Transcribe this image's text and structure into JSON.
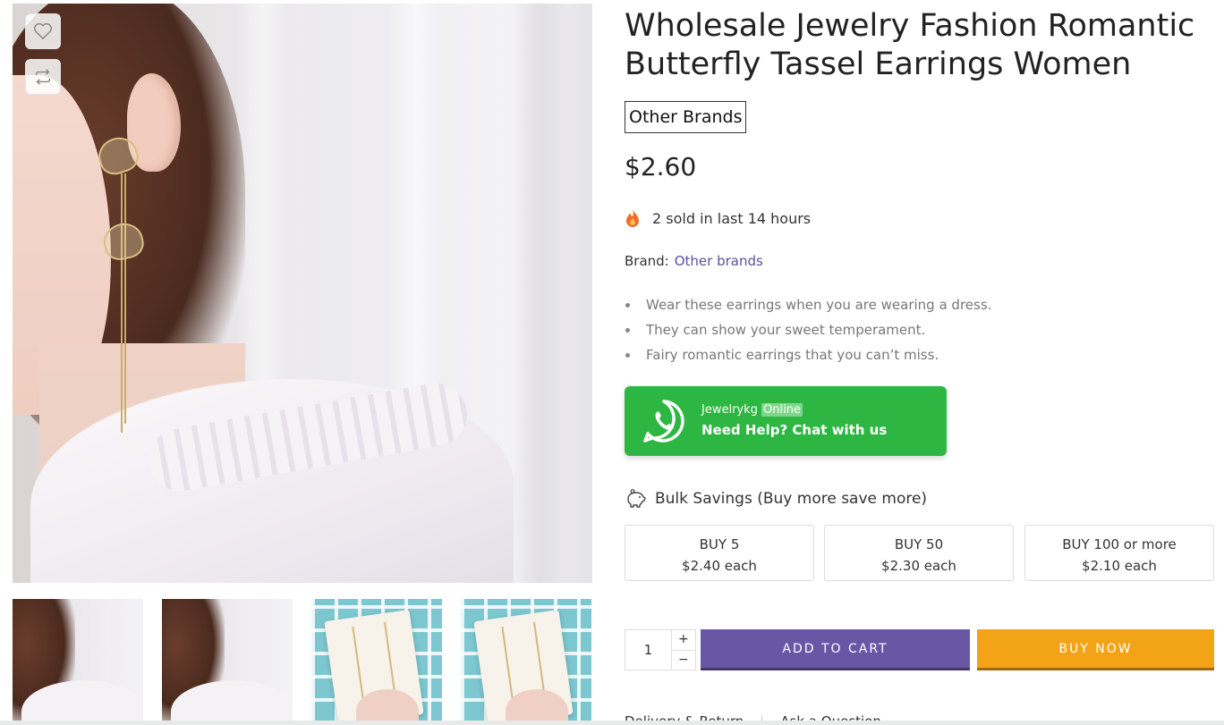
{
  "product": {
    "title": "Wholesale Jewelry Fashion Romantic Butterfly Tassel Earrings Women",
    "brand_chip": "Other Brands",
    "price": "$2.60",
    "sold_text": "2 sold in last 14 hours",
    "brand_label": "Brand:",
    "brand_link": "Other brands",
    "bullets": [
      "Wear these earrings when you are wearing a dress.",
      "They can show your sweet temperament.",
      "Fairy romantic earrings that you can’t miss."
    ]
  },
  "whatsapp": {
    "name": "Jewelrykg",
    "status": "Online",
    "cta": "Need Help? Chat with us",
    "color": "#2db742"
  },
  "bulk": {
    "title": "Bulk Savings (Buy more save more)",
    "tiers": [
      {
        "qty": "BUY 5",
        "price": "$2.40 each"
      },
      {
        "qty": "BUY 50",
        "price": "$2.30 each"
      },
      {
        "qty": "BUY 100 or more",
        "price": "$2.10 each"
      }
    ]
  },
  "cart": {
    "quantity": "1",
    "plus": "+",
    "minus": "−",
    "add_to_cart": "ADD TO CART",
    "buy_now": "BUY NOW",
    "add_color": "#6957a6",
    "buy_color": "#f2a316"
  },
  "gallery": {
    "wishlist_icon": "heart-icon",
    "compare_icon": "repeat-icon",
    "thumbnail_count": 4
  },
  "bottom_links": [
    "Delivery & Return",
    "Ask a Question"
  ]
}
